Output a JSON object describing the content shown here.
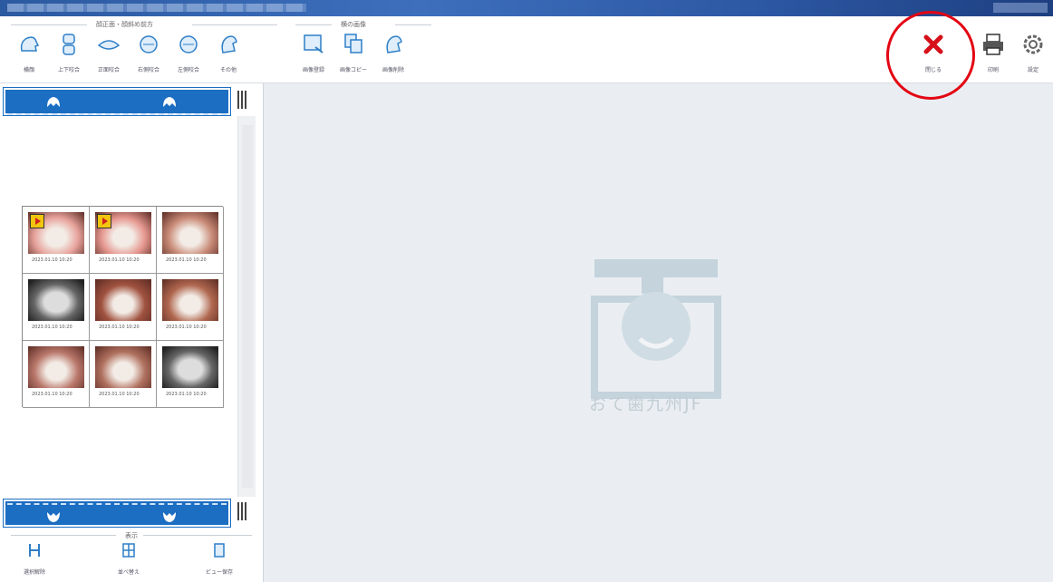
{
  "window": {
    "title": ""
  },
  "ribbon": {
    "group1_caption": "顔正面・顔斜め前方",
    "group2_caption": "横の画像",
    "buttons": [
      {
        "id": "b1",
        "label": "横顔"
      },
      {
        "id": "b2",
        "label": "上下咬合"
      },
      {
        "id": "b3",
        "label": "正面咬合"
      },
      {
        "id": "b4",
        "label": "右側咬合"
      },
      {
        "id": "b5",
        "label": "左側咬合"
      },
      {
        "id": "b6",
        "label": "その他"
      },
      {
        "id": "b7",
        "label": "画像登録"
      },
      {
        "id": "b8",
        "label": "画像コピー"
      },
      {
        "id": "b9",
        "label": "画像削除"
      }
    ],
    "right_buttons": [
      {
        "id": "close",
        "label": "閉じる"
      },
      {
        "id": "print",
        "label": "印刷"
      },
      {
        "id": "settings",
        "label": "設定"
      }
    ]
  },
  "thumbnails": [
    {
      "caption": "2023.01.10 10:20",
      "kind": "video",
      "color": "#e7a39c"
    },
    {
      "caption": "2023.01.10 10:20",
      "kind": "video",
      "color": "#e5978f"
    },
    {
      "caption": "2023.01.10 10:20",
      "kind": "photo",
      "color": "#c98b78"
    },
    {
      "caption": "2023.01.10 10:20",
      "kind": "xray",
      "color": "#8a8a8a"
    },
    {
      "caption": "2023.01.10 10:20",
      "kind": "photo",
      "color": "#a0523f"
    },
    {
      "caption": "2023.01.10 10:20",
      "kind": "photo",
      "color": "#b0674f"
    },
    {
      "caption": "2023.01.10 10:20",
      "kind": "photo",
      "color": "#b9776a"
    },
    {
      "caption": "2023.01.10 10:20",
      "kind": "photo",
      "color": "#b0715f"
    },
    {
      "caption": "2023.01.10 10:20",
      "kind": "xray",
      "color": "#858585"
    }
  ],
  "bottom": {
    "caption": "表示",
    "tools": [
      {
        "id": "t1",
        "label": "選択解除"
      },
      {
        "id": "t2",
        "label": "並べ替え"
      },
      {
        "id": "t3",
        "label": "ビュー保存"
      }
    ]
  },
  "watermark": {
    "text": "おて歯九州JF"
  },
  "colors": {
    "nav_blue": "#1b6ec2",
    "close_red": "#d6101a",
    "highlight_red": "#e30613",
    "main_bg": "#eaeef2"
  }
}
